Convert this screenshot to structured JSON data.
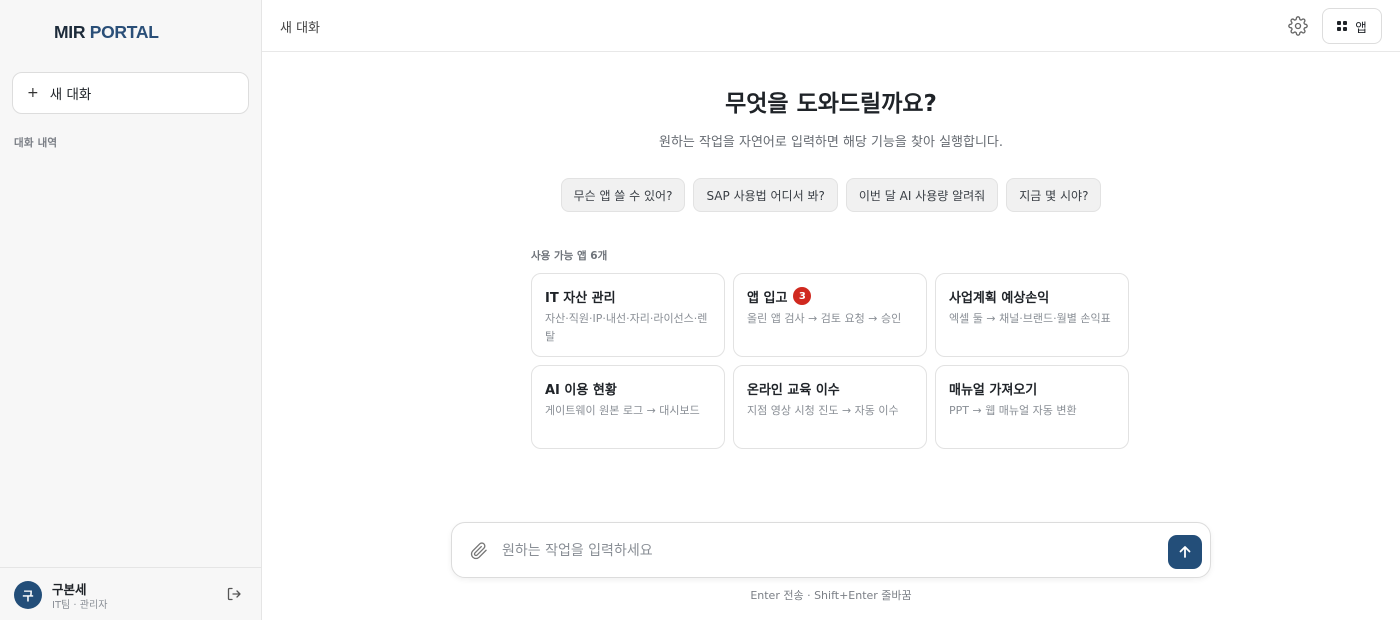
{
  "sidebar": {
    "logo_mir": "MIR",
    "logo_portal": "PORTAL",
    "new_chat_label": "새 대화",
    "history_label": "대화 내역",
    "user": {
      "initial": "구",
      "name": "구본세",
      "role": "IT팀 · 관리자"
    }
  },
  "header": {
    "title": "새 대화",
    "apps_button_label": "앱"
  },
  "main": {
    "title": "무엇을 도와드릴까요?",
    "subtitle": "원하는 작업을 자연어로 입력하면 해당 기능을 찾아 실행합니다.",
    "suggestions": [
      "무슨 앱 쓸 수 있어?",
      "SAP 사용법 어디서 봐?",
      "이번 달 AI 사용량 알려줘",
      "지금 몇 시야?"
    ],
    "apps_label": "사용 가능 앱 6개",
    "apps": [
      {
        "title": "IT 자산 관리",
        "desc": "자산·직원·IP·내선·자리·라이선스·렌탈",
        "badge": ""
      },
      {
        "title": "앱 입고",
        "desc": "올린 앱 검사 → 검토 요청 → 승인",
        "badge": "3"
      },
      {
        "title": "사업계획 예상손익",
        "desc": "엑셀 둘 → 채널·브랜드·월별 손익표",
        "badge": ""
      },
      {
        "title": "AI 이용 현황",
        "desc": "게이트웨이 원본 로그 → 대시보드",
        "badge": ""
      },
      {
        "title": "온라인 교육 이수",
        "desc": "지점 영상 시청 진도 → 자동 이수",
        "badge": ""
      },
      {
        "title": "매뉴얼 가져오기",
        "desc": "PPT → 웹 매뉴얼 자동 변환",
        "badge": ""
      }
    ]
  },
  "composer": {
    "placeholder": "원하는 작업을 입력하세요",
    "value": "",
    "hint": "Enter 전송 · Shift+Enter 줄바꿈"
  },
  "colors": {
    "accent": "#234e79",
    "badge": "#d0291f",
    "sidebar_bg": "#f7f7f7"
  },
  "icons": {
    "new_chat": "plus-icon",
    "settings": "gear-icon",
    "apps": "grid-icon",
    "attach": "paperclip-icon",
    "send": "arrow-up-icon",
    "logout": "logout-icon"
  }
}
